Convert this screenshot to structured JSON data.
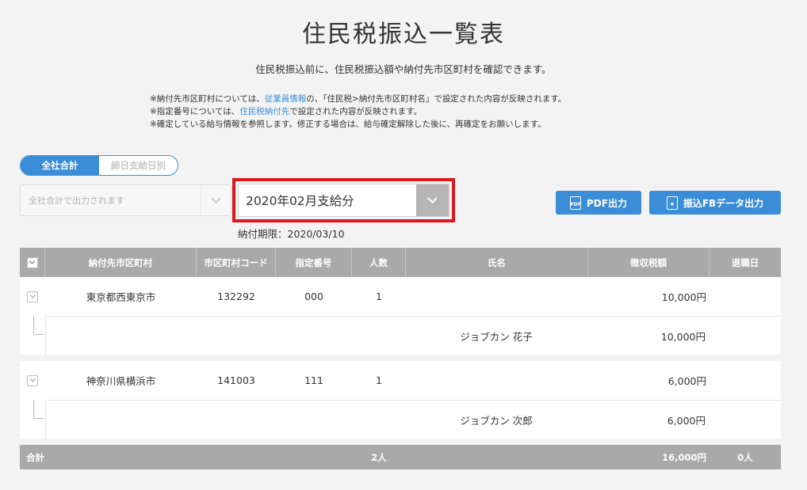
{
  "page": {
    "title": "住民税振込一覧表",
    "subtitle": "住民税振込前に、住民税振込額や納付先市区町村を確認できます。"
  },
  "notes": {
    "line1_a": "※納付先市区町村については、",
    "line1_link": "従業員情報",
    "line1_b": "の、「住民税>納付先市区町村名」で設定された内容が反映されます。",
    "line2_a": "※指定番号については、",
    "line2_link": "住民税納付先",
    "line2_b": "で設定された内容が反映されます。",
    "line3": "※確定している給与情報を参照します。修正する場合は、給与確定解除した後に、再確定をお願いします。"
  },
  "toggle": {
    "all_label": "全社合計",
    "cutoff_label": "締日支給日別"
  },
  "filters": {
    "company_select_placeholder": "全社合計で出力されます",
    "payment_select_value": "2020年02月支給分",
    "deadline": "納付期限：2020/03/10"
  },
  "buttons": {
    "pdf_label": "PDF出力",
    "pdf_icon_text": "PDF",
    "fb_label": "振込FBデータ出力",
    "fb_icon_text": "¥"
  },
  "table": {
    "headers": {
      "municipality": "納付先市区町村",
      "code": "市区町村コード",
      "designation": "指定番号",
      "count": "人数",
      "name": "氏名",
      "tax": "徴収税額",
      "retire": "退職日"
    },
    "groups": [
      {
        "municipality": "東京都西東京市",
        "code": "132292",
        "designation": "000",
        "count": "1",
        "tax": "10,000円",
        "employee": {
          "name": "ジョブカン 花子",
          "tax": "10,000円",
          "retire": ""
        }
      },
      {
        "municipality": "神奈川県横浜市",
        "code": "141003",
        "designation": "111",
        "count": "1",
        "tax": "6,000円",
        "employee": {
          "name": "ジョブカン 次郎",
          "tax": "6,000円",
          "retire": ""
        }
      }
    ],
    "footer": {
      "label": "合計",
      "count": "2人",
      "tax": "16,000円",
      "retire": "0人"
    }
  }
}
